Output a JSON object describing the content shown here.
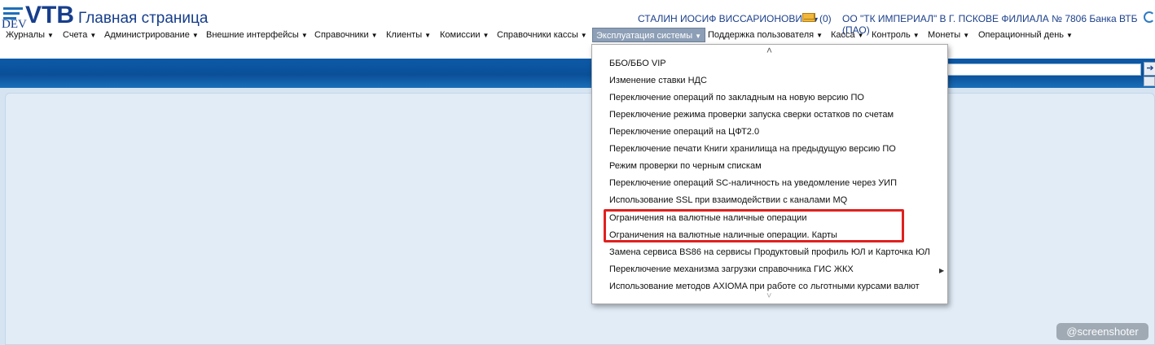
{
  "header": {
    "logo_text": "VTB",
    "logo_env": "DEV",
    "page_title": "Главная страница",
    "user_name": "СТАЛИН ИОСИФ ВИССАРИОНОВИЧ",
    "mail_count": "(0)",
    "organization": "ОО \"ТК ИМПЕРИАЛ\" В Г. ПСКОВЕ ФИЛИАЛА № 7806 Банка ВТБ (ПАО)"
  },
  "menu": {
    "items": [
      {
        "label": "Журналы"
      },
      {
        "label": "Счета"
      },
      {
        "label": "Администрирование"
      },
      {
        "label": "Внешние интерфейсы"
      },
      {
        "label": "Справочники"
      },
      {
        "label": "Клиенты"
      },
      {
        "label": "Комиссии"
      },
      {
        "label": "Справочники кассы"
      },
      {
        "label": "Эксплуатация системы",
        "active": true
      },
      {
        "label": "Поддержка пользователя"
      },
      {
        "label": "Касса"
      },
      {
        "label": "Контроль"
      },
      {
        "label": "Монеты"
      },
      {
        "label": "Операционный день"
      }
    ]
  },
  "dropdown": {
    "items": [
      {
        "label": "ББО/ББО VIP"
      },
      {
        "label": "Изменение ставки НДС"
      },
      {
        "label": "Переключение операций по закладным на новую версию ПО"
      },
      {
        "label": "Переключение режима проверки запуска сверки остатков по счетам"
      },
      {
        "label": "Переключение операций на ЦФТ2.0"
      },
      {
        "label": "Переключение печати Книги хранилища на предыдущую версию ПО"
      },
      {
        "label": "Режим проверки по черным спискам"
      },
      {
        "label": "Переключение операций SC-наличность на уведомление через УИП"
      },
      {
        "label": "Использование SSL при взаимодействии с каналами MQ"
      },
      {
        "label": "Ограничения на валютные наличные операции"
      },
      {
        "label": "Ограничения на валютные наличные операции. Карты"
      },
      {
        "label": "Замена сервиса BS86 на сервисы Продуктовый профиль ЮЛ и Карточка ЮЛ"
      },
      {
        "label": "Переключение механизма загрузки справочника ГИС ЖКХ",
        "has_submenu": true
      },
      {
        "label": "Использование методов AXIOMA при работе со льготными курсами валют"
      }
    ]
  },
  "watermark": "@screenshoter",
  "colors": {
    "brand": "#163e8c",
    "band": "#0d5aa8",
    "highlight": "#e0201e",
    "active_menu": "#8d9fb6"
  }
}
